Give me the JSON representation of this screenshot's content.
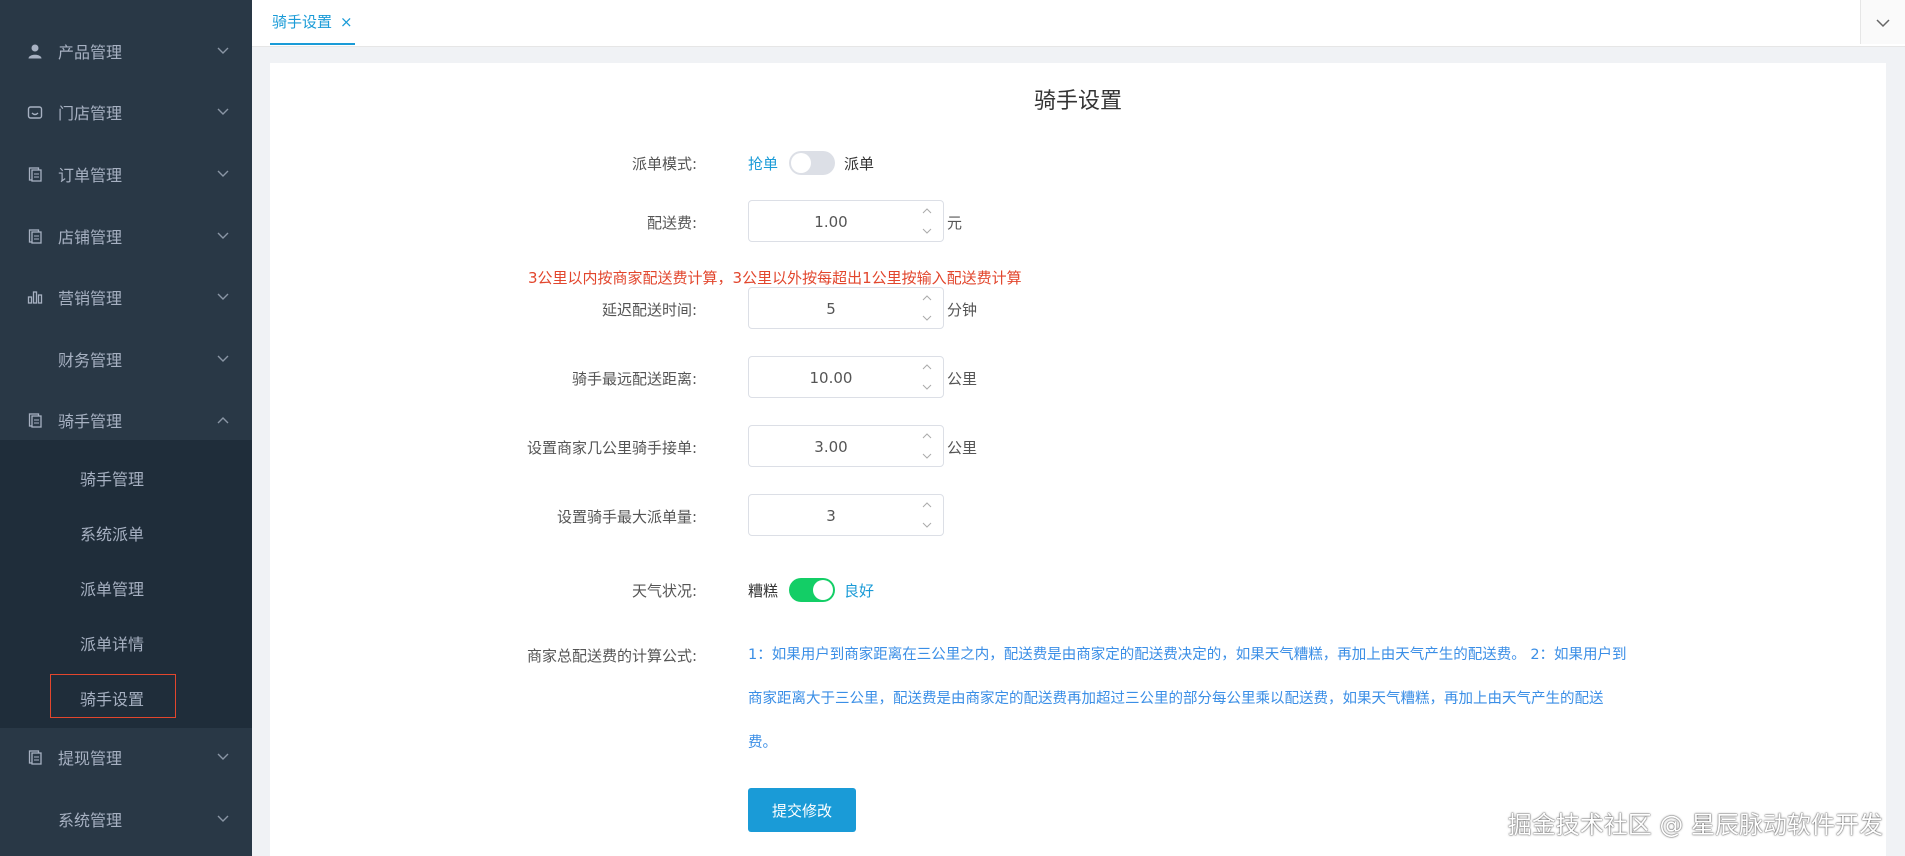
{
  "sidebar": {
    "menus": [
      {
        "label": "产品管理",
        "icon": "user-icon",
        "expanded": false
      },
      {
        "label": "门店管理",
        "icon": "store-icon",
        "expanded": false
      },
      {
        "label": "订单管理",
        "icon": "document-icon",
        "expanded": false
      },
      {
        "label": "店铺管理",
        "icon": "document-icon",
        "expanded": false
      },
      {
        "label": "营销管理",
        "icon": "bar-chart-icon",
        "expanded": false
      },
      {
        "label": "财务管理",
        "icon": "",
        "expanded": false
      },
      {
        "label": "骑手管理",
        "icon": "document-icon",
        "expanded": true
      },
      {
        "label": "提现管理",
        "icon": "document-icon",
        "expanded": false
      },
      {
        "label": "系统管理",
        "icon": "",
        "expanded": false
      }
    ],
    "submenu": [
      "骑手管理",
      "系统派单",
      "派单管理",
      "派单详情",
      "骑手设置"
    ],
    "active_submenu": "骑手设置"
  },
  "tabs": [
    {
      "label": "骑手设置",
      "close": "×"
    }
  ],
  "page": {
    "title": "骑手设置",
    "dispatch_mode": {
      "label": "派单模式:",
      "option_left": "抢单",
      "option_right": "派单",
      "value": "抢单"
    },
    "delivery_fee": {
      "label": "配送费:",
      "value": "1.00",
      "unit": "元"
    },
    "hint": "3公里以内按商家配送费计算，3公里以外按每超出1公里按输入配送费计算",
    "delay_time": {
      "label": "延迟配送时间:",
      "value": "5",
      "unit": "分钟"
    },
    "max_distance": {
      "label": "骑手最远配送距离:",
      "value": "10.00",
      "unit": "公里"
    },
    "merchant_km": {
      "label": "设置商家几公里骑手接单:",
      "value": "3.00",
      "unit": "公里"
    },
    "max_orders": {
      "label": "设置骑手最大派单量:",
      "value": "3",
      "unit": ""
    },
    "weather": {
      "label": "天气状况:",
      "option_left": "糟糕",
      "option_right": "良好",
      "value": "良好"
    },
    "formula": {
      "label": "商家总配送费的计算公式:",
      "text": "1：如果用户到商家距离在三公里之内，配送费是由商家定的配送费决定的，如果天气糟糕，再加上由天气产生的配送费。 2：如果用户到商家距离大于三公里，配送费是由商家定的配送费再加超过三公里的部分每公里乘以配送费，如果天气糟糕，再加上由天气产生的配送费。"
    },
    "submit_label": "提交修改"
  },
  "watermark": "掘金技术社区 @ 星辰脉动软件开发",
  "colors": {
    "accent": "#1a9bd7",
    "sidebar": "#293846",
    "submenu": "#1f2d3a",
    "hint": "#e2462d",
    "switch_on": "#13ce66",
    "switch_off": "#dcdfe6"
  }
}
